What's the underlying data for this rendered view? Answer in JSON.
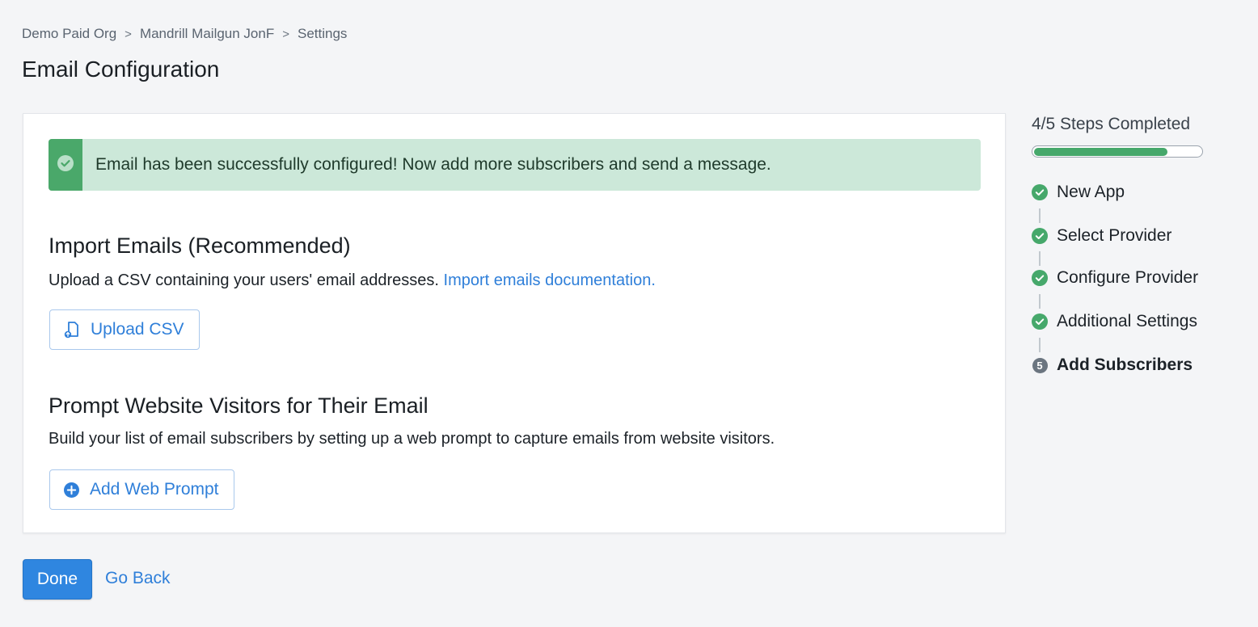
{
  "breadcrumb": {
    "items": [
      "Demo Paid Org",
      "Mandrill Mailgun JonF",
      "Settings"
    ],
    "separator": ">"
  },
  "page": {
    "title": "Email Configuration"
  },
  "alert": {
    "text": "Email has been successfully configured! Now add more subscribers and send a message.",
    "icon": "check-circle-icon",
    "background": "#cce8d9",
    "stripe_color": "#4aa86a"
  },
  "import_section": {
    "title": "Import Emails (Recommended)",
    "description": "Upload a CSV containing your users' email addresses.",
    "link_text": "Import emails documentation.",
    "button_label": "Upload CSV",
    "button_icon": "file-upload-icon"
  },
  "prompt_section": {
    "title": "Prompt Website Visitors for Their Email",
    "description": "Build your list of email subscribers by setting up a web prompt to capture emails from website visitors.",
    "button_label": "Add Web Prompt",
    "button_icon": "plus-circle-icon"
  },
  "footer": {
    "done_label": "Done",
    "back_label": "Go Back"
  },
  "steps": {
    "heading": "4/5 Steps Completed",
    "progress_fraction": 0.8,
    "items": [
      {
        "label": "New App",
        "status": "complete"
      },
      {
        "label": "Select Provider",
        "status": "complete"
      },
      {
        "label": "Configure Provider",
        "status": "complete"
      },
      {
        "label": "Additional Settings",
        "status": "complete"
      },
      {
        "label": "Add Subscribers",
        "status": "current",
        "number": "5"
      }
    ]
  },
  "colors": {
    "accent": "#2f7fd9",
    "primary_button": "#2f86e0",
    "success": "#46a86b"
  }
}
